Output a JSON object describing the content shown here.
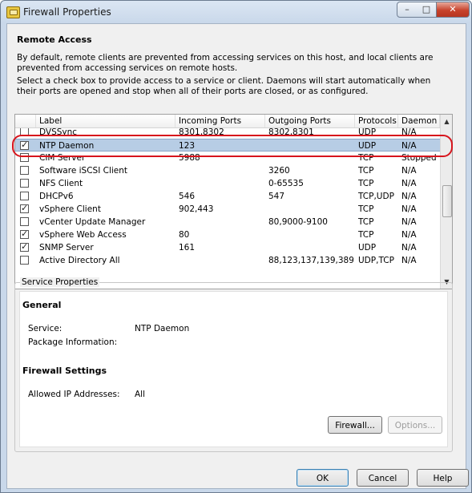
{
  "window": {
    "title": "Firewall Properties",
    "min_label": "–",
    "max_label": "□",
    "close_label": "✕"
  },
  "remote_access": {
    "heading": "Remote Access",
    "description1": "By default, remote clients are prevented from accessing services on this host, and local clients are prevented from accessing services on remote hosts.",
    "description2": "Select a check box to provide access to a service or client. Daemons will start automatically when their ports are opened and stop when all of their ports are closed, or as configured."
  },
  "table": {
    "columns": [
      "Label",
      "Incoming Ports",
      "Outgoing Ports",
      "Protocols",
      "Daemon"
    ],
    "rows": [
      {
        "checked": false,
        "label": "DVSSync",
        "incoming": "8301,8302",
        "outgoing": "8302,8301",
        "protocols": "UDP",
        "daemon": "N/A"
      },
      {
        "checked": true,
        "label": "NTP Daemon",
        "incoming": "123",
        "outgoing": "",
        "protocols": "UDP",
        "daemon": "N/A",
        "selected": true
      },
      {
        "checked": false,
        "label": "CIM Server",
        "incoming": "5988",
        "outgoing": "",
        "protocols": "TCP",
        "daemon": "Stopped"
      },
      {
        "checked": false,
        "label": "Software iSCSI Client",
        "incoming": "",
        "outgoing": "3260",
        "protocols": "TCP",
        "daemon": "N/A"
      },
      {
        "checked": false,
        "label": "NFS Client",
        "incoming": "",
        "outgoing": "0-65535",
        "protocols": "TCP",
        "daemon": "N/A"
      },
      {
        "checked": false,
        "label": "DHCPv6",
        "incoming": "546",
        "outgoing": "547",
        "protocols": "TCP,UDP",
        "daemon": "N/A"
      },
      {
        "checked": true,
        "label": "vSphere Client",
        "incoming": "902,443",
        "outgoing": "",
        "protocols": "TCP",
        "daemon": "N/A"
      },
      {
        "checked": false,
        "label": "vCenter Update Manager",
        "incoming": "",
        "outgoing": "80,9000-9100",
        "protocols": "TCP",
        "daemon": "N/A"
      },
      {
        "checked": true,
        "label": "vSphere Web Access",
        "incoming": "80",
        "outgoing": "",
        "protocols": "TCP",
        "daemon": "N/A"
      },
      {
        "checked": true,
        "label": "SNMP Server",
        "incoming": "161",
        "outgoing": "",
        "protocols": "UDP",
        "daemon": "N/A"
      },
      {
        "checked": false,
        "label": "Active Directory All",
        "incoming": "",
        "outgoing": "88,123,137,139,389",
        "protocols": "UDP,TCP",
        "daemon": "N/A"
      }
    ]
  },
  "service_properties": {
    "legend": "Service Properties",
    "general_title": "General",
    "service_label": "Service:",
    "service_value": "NTP Daemon",
    "package_label": "Package Information:",
    "firewall_title": "Firewall Settings",
    "allowed_label": "Allowed IP Addresses:",
    "allowed_value": "All",
    "firewall_button": "Firewall...",
    "options_button": "Options..."
  },
  "footer": {
    "ok": "OK",
    "cancel": "Cancel",
    "help": "Help"
  },
  "colors": {
    "selection": "#b7cde5",
    "annotation": "#d7141c"
  }
}
